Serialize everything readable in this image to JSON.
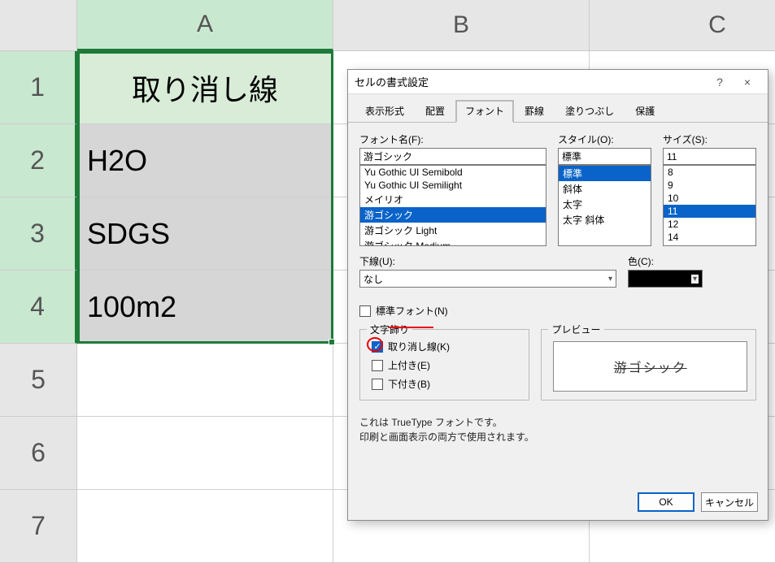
{
  "sheet": {
    "cols": [
      "A",
      "B",
      "C"
    ],
    "rows": [
      "1",
      "2",
      "3",
      "4",
      "5",
      "6",
      "7"
    ],
    "cells": {
      "A1": "取り消し線",
      "A2": "H2O",
      "A3": "SDGS",
      "A4": "100m2"
    },
    "selected_cols": [
      "A"
    ],
    "selected_rows": [
      "1",
      "2",
      "3",
      "4"
    ]
  },
  "dialog": {
    "title": "セルの書式設定",
    "tabs": [
      "表示形式",
      "配置",
      "フォント",
      "罫線",
      "塗りつぶし",
      "保護"
    ],
    "active_tab": "フォント",
    "font_name_label": "フォント名(F):",
    "font_name_value": "游ゴシック",
    "font_list": [
      "Yu Gothic UI Semibold",
      "Yu Gothic UI Semilight",
      "メイリオ",
      "游ゴシック",
      "游ゴシック Light",
      "游ゴシック Medium"
    ],
    "font_list_selected": "游ゴシック",
    "style_label": "スタイル(O):",
    "style_value": "標準",
    "style_list": [
      "標準",
      "斜体",
      "太字",
      "太字 斜体"
    ],
    "style_selected": "標準",
    "size_label": "サイズ(S):",
    "size_value": "11",
    "size_list": [
      "8",
      "9",
      "10",
      "11",
      "12",
      "14"
    ],
    "size_selected": "11",
    "underline_label": "下線(U):",
    "underline_value": "なし",
    "color_label": "色(C):",
    "normal_font_label": "標準フォント(N)",
    "effects_label": "文字飾り",
    "effects": {
      "strike": "取り消し線(K)",
      "super": "上付き(E)",
      "sub": "下付き(B)"
    },
    "effects_checked": {
      "strike": true,
      "super": false,
      "sub": false
    },
    "preview_label": "プレビュー",
    "preview_text": "游ゴシック",
    "info_line1": "これは TrueType フォントです。",
    "info_line2": "印刷と画面表示の両方で使用されます。",
    "ok": "OK",
    "cancel": "キャンセル",
    "help": "?",
    "close": "×"
  }
}
